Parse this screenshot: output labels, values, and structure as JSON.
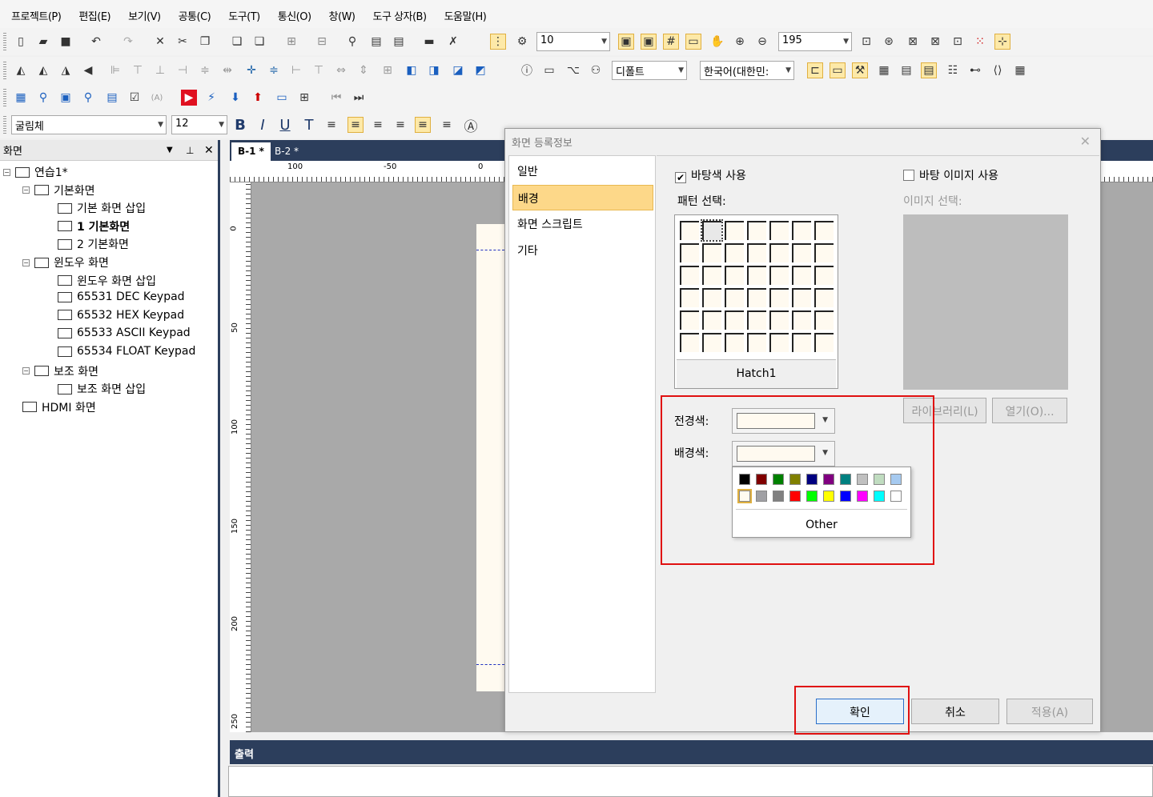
{
  "menu": [
    "프로젝트(P)",
    "편집(E)",
    "보기(V)",
    "공통(C)",
    "도구(T)",
    "통신(O)",
    "창(W)",
    "도구 상자(B)",
    "도움말(H)"
  ],
  "toolbar": {
    "grid_size": "10",
    "zoom": "195",
    "text_style": "디폴트",
    "language": "한국어(대한민:",
    "font_name": "굴림체",
    "font_size": "12"
  },
  "left_panel": {
    "title": "화면",
    "tree": [
      {
        "label": "연습1*",
        "level": 0
      },
      {
        "label": "기본화면",
        "level": 1
      },
      {
        "label": "기본 화면 삽입",
        "level": 2
      },
      {
        "label": "1 기본화면",
        "level": 2,
        "bold": true
      },
      {
        "label": "2 기본화면",
        "level": 2
      },
      {
        "label": "윈도우 화면",
        "level": 1
      },
      {
        "label": "윈도우 화면 삽입",
        "level": 2
      },
      {
        "label": "65531 DEC Keypad",
        "level": 2
      },
      {
        "label": "65532 HEX Keypad",
        "level": 2
      },
      {
        "label": "65533 ASCII Keypad",
        "level": 2
      },
      {
        "label": "65534 FLOAT Keypad",
        "level": 2
      },
      {
        "label": "보조 화면",
        "level": 1
      },
      {
        "label": "보조 화면 삽입",
        "level": 2
      },
      {
        "label": "HDMI 화면",
        "level": 1
      }
    ]
  },
  "editor": {
    "tabs": [
      "B-1 *",
      "B-2 *"
    ],
    "ruler_h": [
      "100",
      "-50",
      "0"
    ],
    "ruler_v": [
      "0",
      "50",
      "100",
      "150",
      "200",
      "250"
    ]
  },
  "output": {
    "title": "출력"
  },
  "dialog": {
    "title": "화면 등록정보",
    "nav": [
      "일반",
      "배경",
      "화면 스크립트",
      "기타"
    ],
    "selected_nav": "배경",
    "bg_color_use": "바탕색 사용",
    "bg_image_use": "바탕 이미지 사용",
    "pattern_label": "패턴 선택:",
    "image_label": "이미지 선택:",
    "pattern_name": "Hatch1",
    "library_btn": "라이브러리(L)",
    "open_btn": "열기(O)...",
    "fg_label": "전경색:",
    "bg_label": "배경색:",
    "other_btn": "Other",
    "ok_btn": "확인",
    "cancel_btn": "취소",
    "apply_btn": "적용(A)"
  },
  "palette_colors": [
    "#000000",
    "#800000",
    "#008000",
    "#808000",
    "#000080",
    "#800080",
    "#008080",
    "#c0c0c0",
    "#c0dcc0",
    "#a6caf0",
    "#fffbf0",
    "#a0a0a4",
    "#808080",
    "#ff0000",
    "#00ff00",
    "#ffff00",
    "#0000ff",
    "#ff00ff",
    "#00ffff",
    "#ffffff"
  ]
}
